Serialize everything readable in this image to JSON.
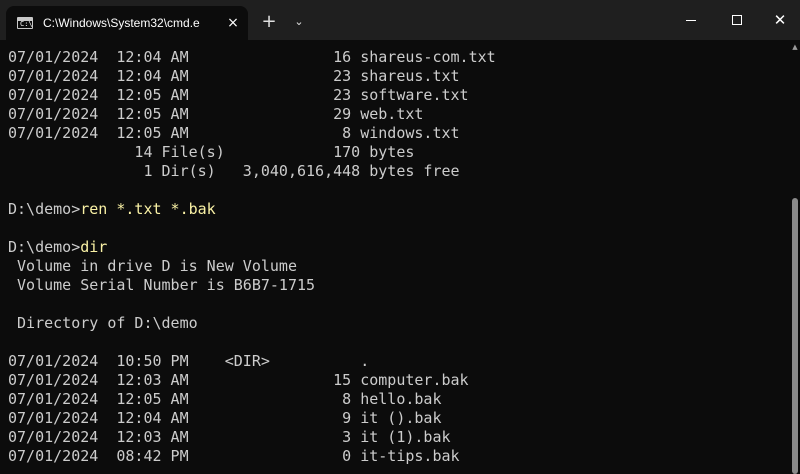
{
  "window": {
    "tab_title": "C:\\Windows\\System32\\cmd.e",
    "tab_close": "×",
    "new_tab": "+",
    "dropdown": "⌄",
    "close": "✕"
  },
  "console": {
    "lines": [
      {
        "text": "07/01/2024  12:04 AM                16 shareus-com.txt"
      },
      {
        "text": "07/01/2024  12:04 AM                23 shareus.txt"
      },
      {
        "text": "07/01/2024  12:05 AM                23 software.txt"
      },
      {
        "text": "07/01/2024  12:05 AM                29 web.txt"
      },
      {
        "text": "07/01/2024  12:05 AM                 8 windows.txt"
      },
      {
        "text": "              14 File(s)            170 bytes"
      },
      {
        "text": "               1 Dir(s)   3,040,616,448 bytes free"
      },
      {
        "text": ""
      },
      {
        "prompt": "D:\\demo>",
        "command": "ren *.txt *.bak"
      },
      {
        "text": ""
      },
      {
        "prompt": "D:\\demo>",
        "command": "dir"
      },
      {
        "text": " Volume in drive D is New Volume"
      },
      {
        "text": " Volume Serial Number is B6B7-1715"
      },
      {
        "text": ""
      },
      {
        "text": " Directory of D:\\demo"
      },
      {
        "text": ""
      },
      {
        "text": "07/01/2024  10:50 PM    <DIR>          ."
      },
      {
        "text": "07/01/2024  12:03 AM                15 computer.bak"
      },
      {
        "text": "07/01/2024  12:05 AM                 8 hello.bak"
      },
      {
        "text": "07/01/2024  12:04 AM                 9 it ().bak"
      },
      {
        "text": "07/01/2024  12:03 AM                 3 it (1).bak"
      },
      {
        "text": "07/01/2024  08:42 PM                 0 it-tips.bak"
      }
    ]
  },
  "colors": {
    "background": "#0c0c0c",
    "text": "#cccccc",
    "command": "#f9f1a5",
    "titlebar": "#1f1f1f"
  }
}
